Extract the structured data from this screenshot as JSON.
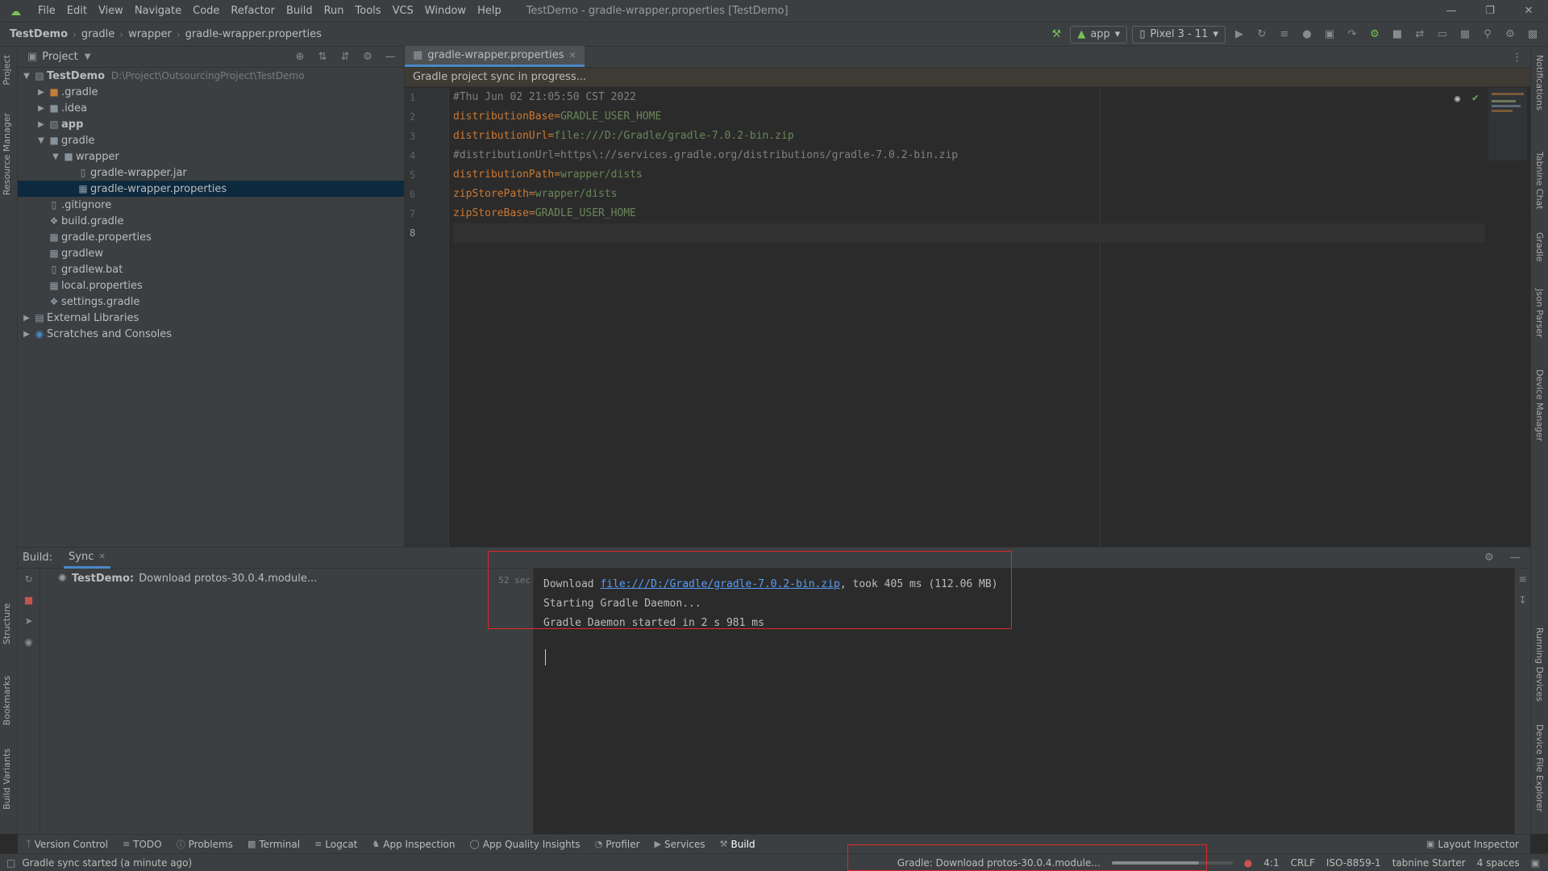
{
  "menu": {
    "items": [
      "File",
      "Edit",
      "View",
      "Navigate",
      "Code",
      "Refactor",
      "Build",
      "Run",
      "Tools",
      "VCS",
      "Window",
      "Help"
    ],
    "window_title": "TestDemo - gradle-wrapper.properties [TestDemo]"
  },
  "nav": {
    "crumbs": [
      "TestDemo",
      "gradle",
      "wrapper",
      "gradle-wrapper.properties"
    ],
    "run_config": "app",
    "device": "Pixel 3 - 11"
  },
  "project_panel": {
    "title": "Project",
    "root": {
      "label": "TestDemo",
      "path": "D:\\Project\\OutsourcingProject\\TestDemo"
    },
    "items": [
      ".gradle",
      ".idea",
      "app",
      "gradle",
      "wrapper",
      "gradle-wrapper.jar",
      "gradle-wrapper.properties",
      ".gitignore",
      "build.gradle",
      "gradle.properties",
      "gradlew",
      "gradlew.bat",
      "local.properties",
      "settings.gradle",
      "External Libraries",
      "Scratches and Consoles"
    ]
  },
  "editor": {
    "tab_label": "gradle-wrapper.properties",
    "banner": "Gradle project sync in progress...",
    "line_numbers": [
      "1",
      "2",
      "3",
      "4",
      "5",
      "6",
      "7",
      "8"
    ],
    "lines": [
      {
        "comment": "#Thu Jun 02 21:05:50 CST 2022"
      },
      {
        "key": "distributionBase",
        "value": "GRADLE_USER_HOME"
      },
      {
        "key": "distributionUrl",
        "value": "file:///D:/Gradle/gradle-7.0.2-bin.zip"
      },
      {
        "comment": "#distributionUrl=https\\://services.gradle.org/distributions/gradle-7.0.2-bin.zip"
      },
      {
        "key": "distributionPath",
        "value": "wrapper/dists"
      },
      {
        "key": "zipStorePath",
        "value": "wrapper/dists"
      },
      {
        "key": "zipStoreBase",
        "value": "GRADLE_USER_HOME"
      }
    ]
  },
  "build": {
    "label": "Build:",
    "tab": "Sync",
    "tree_item": "TestDemo:",
    "tree_item_detail": "Download protos-30.0.4.module...",
    "time": "52 sec",
    "log": {
      "line1_prefix": "Download ",
      "line1_link": "file:///D:/Gradle/gradle-7.0.2-bin.zip",
      "line1_suffix": ", took 405 ms (112.06 MB)",
      "line2": "Starting Gradle Daemon...",
      "line3": "Gradle Daemon started in 2 s 981 ms"
    }
  },
  "side_labels": {
    "left_top": [
      "Project",
      "Resource Manager"
    ],
    "left_bottom": [
      "Structure",
      "Bookmarks",
      "Build Variants"
    ],
    "right": [
      "Notifications",
      "Tabnine Chat",
      "Gradle",
      "Json Parser",
      "Device Manager",
      "Running Devices",
      "Device File Explorer"
    ]
  },
  "bottom_tabs": [
    "Version Control",
    "TODO",
    "Problems",
    "Terminal",
    "Logcat",
    "App Inspection",
    "App Quality Insights",
    "Profiler",
    "Services",
    "Build"
  ],
  "bottom_right": {
    "layout_inspector": "Layout Inspector"
  },
  "status": {
    "left": "Gradle sync started (a minute ago)",
    "task": "Gradle: Download protos-30.0.4.module...",
    "progress_fraction": 0.72,
    "position": "4:1",
    "line_sep": "CRLF",
    "encoding": "ISO-8859-1",
    "tabnine": "tabnine Starter",
    "indent": "4 spaces"
  },
  "colors": {
    "accent": "#4a88c7",
    "highlight_border": "#e0272b",
    "key": "#cc7832",
    "value": "#6a8759"
  }
}
